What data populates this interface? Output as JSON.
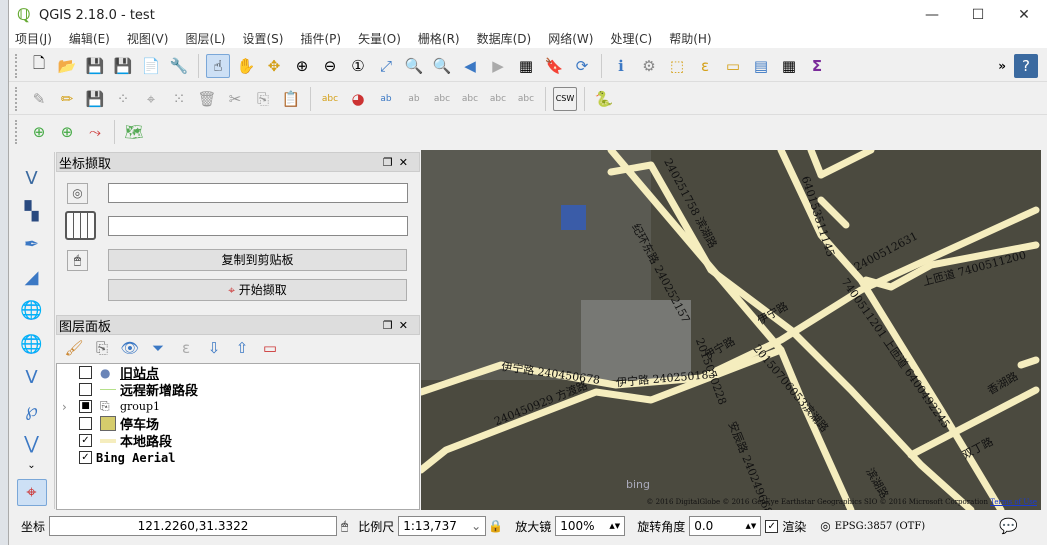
{
  "window": {
    "title": "QGIS 2.18.0 - test",
    "minimize": "—",
    "maximize": "☐",
    "close": "✕"
  },
  "menu": [
    "项目(J)",
    "编辑(E)",
    "视图(V)",
    "图层(L)",
    "设置(S)",
    "插件(P)",
    "矢量(O)",
    "栅格(R)",
    "数据库(D)",
    "网络(W)",
    "处理(C)",
    "帮助(H)"
  ],
  "toolbar1": {
    "overflow": "»"
  },
  "toolbar2": {
    "csw": "CSW"
  },
  "coord_panel": {
    "title": "坐标撷取",
    "field1": "",
    "field2": "",
    "copy_button": "复制到剪贴板",
    "start_button": "开始撷取"
  },
  "layers_panel": {
    "title": "图层面板",
    "layers": [
      {
        "name": "旧站点",
        "checked": false
      },
      {
        "name": "远程新增路段",
        "checked": false
      },
      {
        "name": "group1",
        "checked": "partial"
      },
      {
        "name": "停车场",
        "checked": false
      },
      {
        "name": "本地路段",
        "checked": true
      },
      {
        "name": "Bing Aerial",
        "checked": true
      }
    ]
  },
  "map": {
    "labels": [
      "240251758 滨湖路",
      "纪环东路 240252157",
      "伊宁路 240450678",
      "伊宁路 240250183",
      "240450929 方渡路",
      "2015070228",
      "伊宁路",
      "伊宁路",
      "20150706053滨湖路",
      "安辰路 240249668",
      "640153511145",
      "2400512631",
      "上匝道 7400511200",
      "7400511201 上匝道 6400492245",
      "双丁路",
      "滨湖路",
      "香湖路"
    ],
    "bing": "bing",
    "copyright": "© 2016 DigitalGlobe © 2016 GeoEye Earthstar Geographics SIO © 2016 Microsoft Corporation",
    "terms": "Terms of Use"
  },
  "status": {
    "coord_label": "坐标",
    "coord_value": "121.2260,31.3322",
    "scale_label": "比例尺",
    "scale_value": "1:13,737",
    "magnifier_label": "放大镜",
    "magnifier_value": "100%",
    "rotation_label": "旋转角度",
    "rotation_value": "0.0",
    "render_label": "渲染",
    "crs": "EPSG:3857 (OTF)"
  },
  "colors": {
    "road": "#f5edbe",
    "accent": "#3b78c4"
  }
}
